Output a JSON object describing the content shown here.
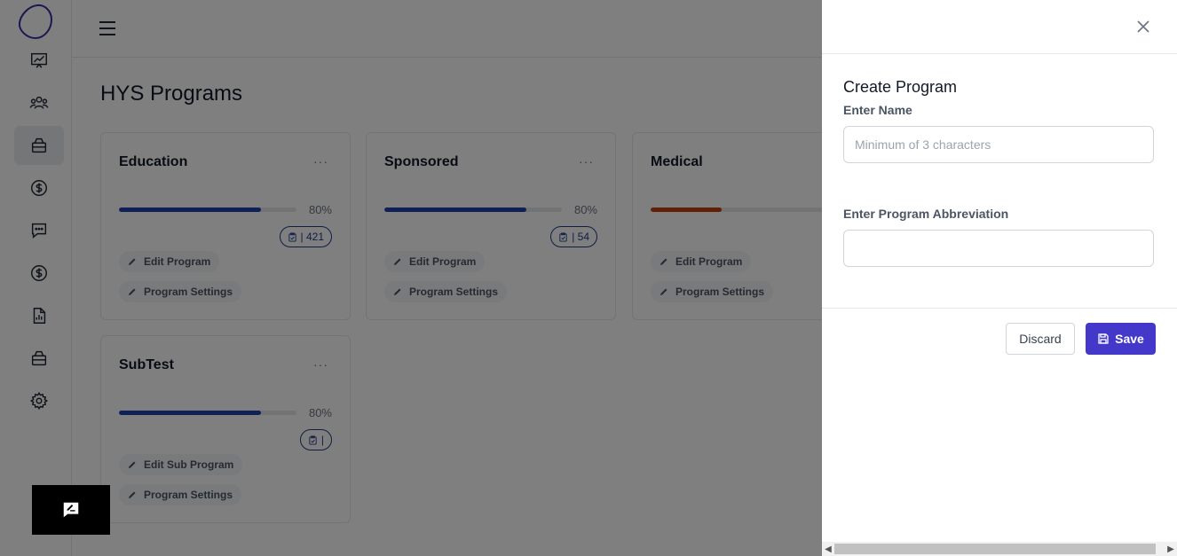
{
  "page": {
    "title": "HYS Programs"
  },
  "sidebar": {
    "items": [
      {
        "icon": "dashboard-chart-icon"
      },
      {
        "icon": "users-icon"
      },
      {
        "icon": "programs-icon"
      },
      {
        "icon": "dollar-icon"
      },
      {
        "icon": "message-icon"
      },
      {
        "icon": "dollar-icon"
      },
      {
        "icon": "report-icon"
      },
      {
        "icon": "programs-icon"
      },
      {
        "icon": "gear-icon"
      }
    ]
  },
  "cards": [
    {
      "title": "Education",
      "menu": "···",
      "progress": 80,
      "progress_label": "80%",
      "count_label": "| 421",
      "actions": [
        "Edit Program",
        "Program Settings"
      ]
    },
    {
      "title": "Sponsored",
      "menu": "···",
      "progress": 80,
      "progress_label": "80%",
      "count_label": "| 54",
      "actions": [
        "Edit Program",
        "Program Settings"
      ]
    },
    {
      "title": "Medical",
      "menu": "···",
      "progress": 40,
      "progress_label": "",
      "count_label": "",
      "actions": [
        "Edit Program",
        "Program Settings"
      ]
    },
    {
      "title": "SubTest",
      "menu": "···",
      "progress": 80,
      "progress_label": "80%",
      "count_label": "|",
      "actions": [
        "Edit Sub Program",
        "Program Settings"
      ]
    }
  ],
  "drawer": {
    "title": "Create Program",
    "name_label": "Enter Name",
    "name_placeholder": "Minimum of 3 characters",
    "name_value": "",
    "abbr_label": "Enter Program Abbreviation",
    "abbr_value": "",
    "discard_label": "Discard",
    "save_label": "Save"
  },
  "colors": {
    "accent": "#4338ca",
    "progress_blue": "#1e40af",
    "progress_orange": "#c2410c"
  }
}
